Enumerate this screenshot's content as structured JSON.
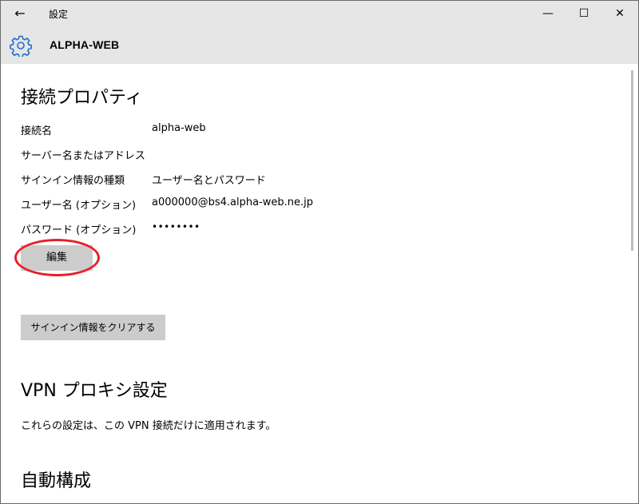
{
  "window": {
    "title": "設定",
    "back_glyph": "←",
    "minimize_glyph": "—",
    "maximize_glyph": "☐",
    "close_glyph": "✕"
  },
  "header": {
    "icon": "gear-icon",
    "title": "ALPHA-WEB",
    "accent_color": "#1f6fd1"
  },
  "connection_properties": {
    "title": "接続プロパティ",
    "rows": [
      {
        "label": "接続名",
        "value": "alpha-web"
      },
      {
        "label": "サーバー名またはアドレス",
        "value": ""
      },
      {
        "label": "サインイン情報の種類",
        "value": "ユーザー名とパスワード"
      },
      {
        "label": "ユーザー名 (オプション)",
        "value": "a000000@bs4.alpha-web.ne.jp"
      },
      {
        "label": "パスワード (オプション)",
        "value": "••••••••"
      }
    ],
    "edit_button": "編集",
    "clear_button": "サインイン情報をクリアする",
    "highlight_color": "#e8202a"
  },
  "vpn_proxy": {
    "title": "VPN プロキシ設定",
    "description": "これらの設定は、この VPN 接続だけに適用されます。"
  },
  "auto_config": {
    "title": "自動構成"
  }
}
